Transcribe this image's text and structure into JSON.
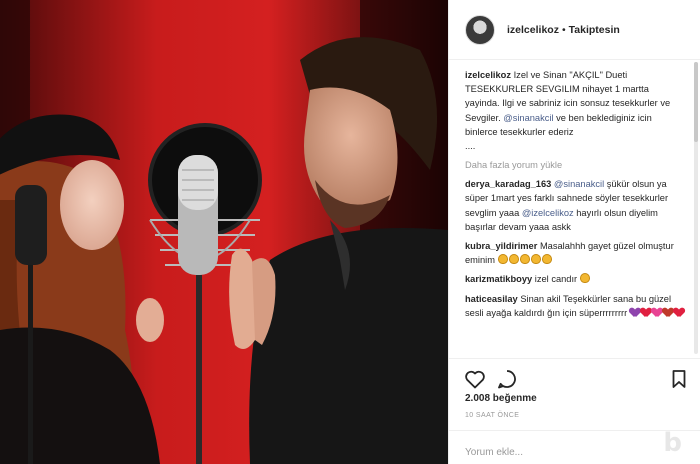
{
  "post": {
    "image_alt": "",
    "header": {
      "username": "izelcelikoz",
      "separator": "•",
      "follow_status": "Takiptesin"
    },
    "caption": {
      "username": "izelcelikoz",
      "text_1": "Izel ve Sinan \"AKÇIL\" Dueti TESEKKURLER SEVGILIM nihayet 1 martta yayinda. Ilgi ve sabriniz icin sonsuz tesekkurler ve Sevgiler.",
      "mention": "@sinanakcil",
      "text_2": "ve ben beklediginiz icin binlerce tesekkurler ederiz",
      "ellipsis": "...."
    },
    "load_more": "Daha fazla yorum yükle",
    "comments": [
      {
        "username": "derya_karadag_163",
        "mention_1": "@sinanakcil",
        "text_1": "şükür olsun ya süper 1mart yes farklı sahnede söyler tesekkurler sevglim yaaa",
        "mention_2": "@izelcelikoz",
        "text_2": "hayırlı olsun diyelim başırlar devam yaaa askk"
      },
      {
        "username": "kubra_yildirimer",
        "text": "Masalahhh gayet güzel olmuştur eminim",
        "emoji": "clap-emoji"
      },
      {
        "username": "karizmatikboyy",
        "text": "izel candır",
        "emoji": "clap-emoji"
      },
      {
        "username": "haticeasilay",
        "text": "Sinan akil Teşekkürler sana bu güzel sesli ayağa kaldırdı ğın için süperrrrrrrrr",
        "emoji": "heart-emojis"
      }
    ],
    "actions": {
      "like_icon": "heart-icon",
      "comment_icon": "comment-bubble-icon",
      "save_icon": "bookmark-icon"
    },
    "likes": "2.008 beğenme",
    "time": "10 SAAT ÖNCE",
    "add_comment_placeholder": "Yorum ekle..."
  },
  "colors": {
    "mention": "#4a5e8a",
    "muted": "#999999",
    "text": "#262626",
    "border": "#efefef"
  }
}
